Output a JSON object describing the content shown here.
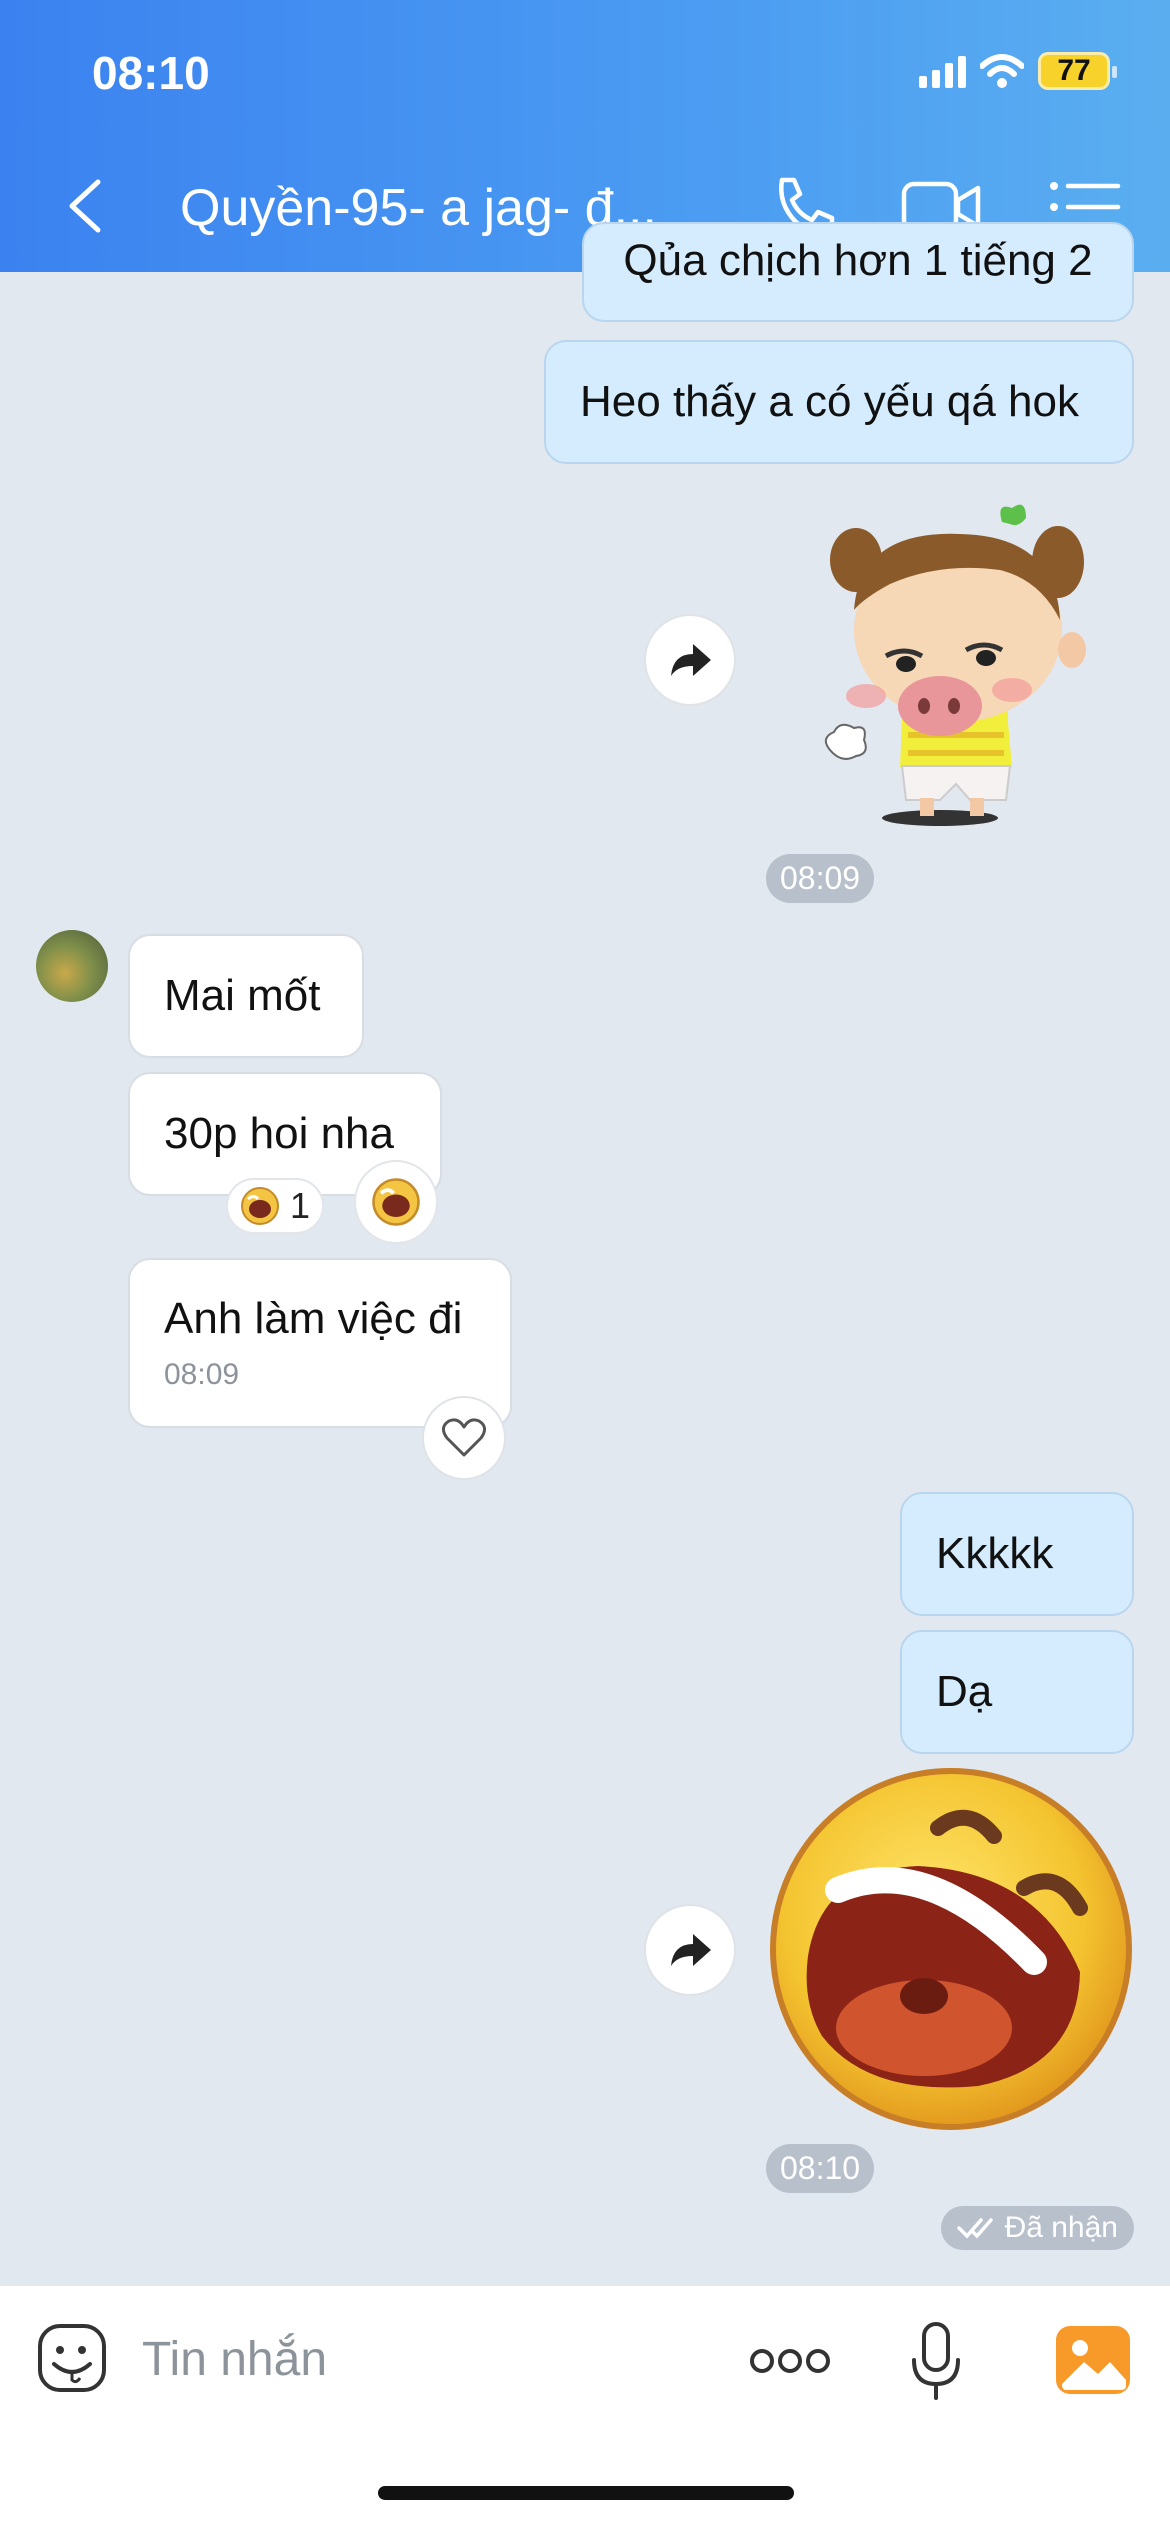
{
  "status_bar": {
    "time": "08:10",
    "battery": "77"
  },
  "header": {
    "title": "Quyền-95- a jag- đ..."
  },
  "messages": {
    "cut_top_text": "Qủa chịch hơn 1 tiếng 2",
    "out1": "Heo thấy a có yếu qá hok",
    "time1": "08:09",
    "in1": "Mai mốt",
    "in2": "30p hoi nha",
    "reaction_count": "1",
    "in3": "Anh làm việc đi",
    "in3_time": "08:09",
    "out2": "Kkkkk",
    "out3": "Dạ",
    "time2": "08:10",
    "receipt": "Đã nhận"
  },
  "input": {
    "placeholder": "Tin nhắn"
  }
}
